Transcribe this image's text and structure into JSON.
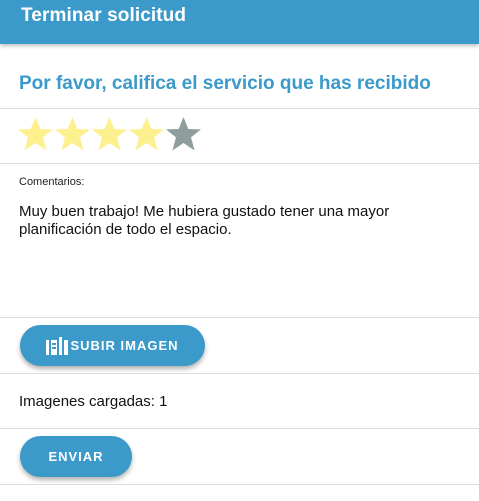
{
  "header": {
    "title": "Terminar solicitud"
  },
  "rating": {
    "prompt": "Por favor, califica el servicio que has recibido",
    "value": 4,
    "max": 5
  },
  "comments": {
    "label": "Comentarios:",
    "text": "Muy buen trabajo! Me hubiera gustado tener una mayor planificación de todo el espacio."
  },
  "upload": {
    "button_label": "SUBIR IMAGEN",
    "icon": "image-upload-icon"
  },
  "uploaded": {
    "text": "Imagenes cargadas: 1"
  },
  "submit": {
    "button_label": "ENVIAR"
  },
  "colors": {
    "primary": "#3b9ac9",
    "star_filled": "#fdf08e",
    "star_empty": "#8e9e9a"
  }
}
